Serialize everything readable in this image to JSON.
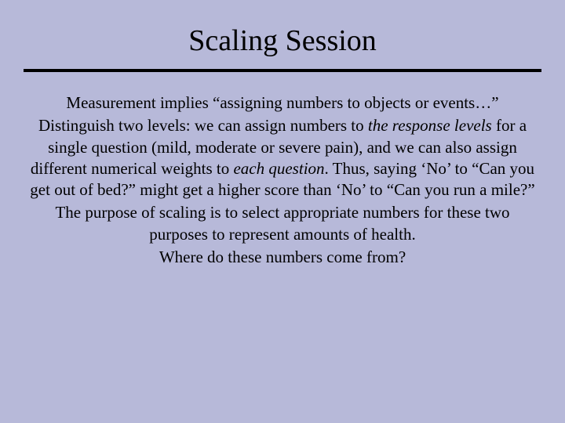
{
  "title": "Scaling Session",
  "para1_a": "Measurement implies “assigning numbers to objects or events…”",
  "para2_a": "Distinguish two levels: we can assign numbers to ",
  "para2_b": "the response levels",
  "para2_c": " for a single question (mild, moderate or severe pain), and we can also assign different numerical weights to ",
  "para2_d": "each question",
  "para2_e": ".  Thus, saying ‘No’ to “Can you get out of bed?” might get a higher score than ‘No’ to “Can you run a mile?”",
  "para3": "The purpose of scaling is to select appropriate numbers for these two purposes to represent amounts of health.",
  "para4": "Where do these numbers come from?"
}
